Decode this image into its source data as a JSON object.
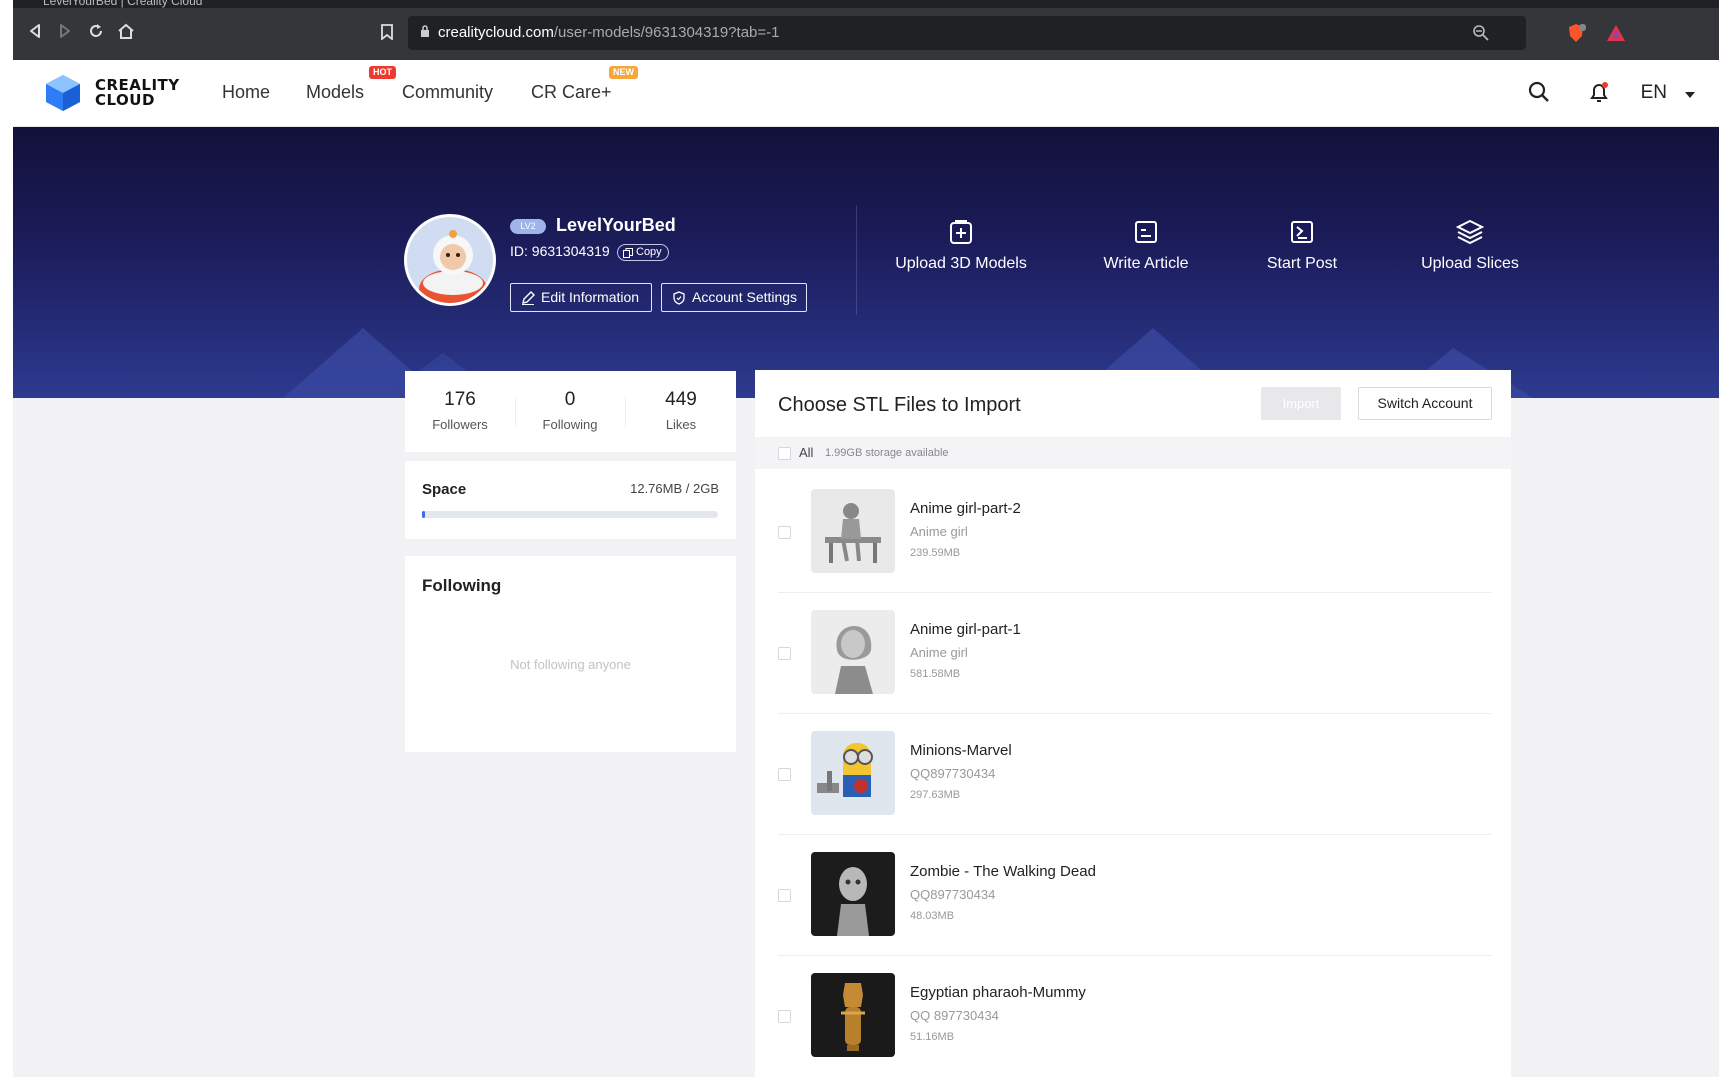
{
  "browser": {
    "tab_title": "LevelYourBed | Creality Cloud",
    "url_host": "crealitycloud.com",
    "url_path": "/user-models/9631304319?tab=-1"
  },
  "header": {
    "logo_line1": "CREALITY",
    "logo_line2": "CLOUD",
    "nav": [
      {
        "label": "Home"
      },
      {
        "label": "Models",
        "badge": "HOT"
      },
      {
        "label": "Community"
      },
      {
        "label": "CR Care+",
        "badge": "NEW"
      }
    ],
    "language": "EN"
  },
  "profile": {
    "level": "LV2",
    "username": "LevelYourBed",
    "id_text": "ID: 9631304319",
    "copy_label": "Copy",
    "edit_label": "Edit Information",
    "settings_label": "Account Settings"
  },
  "actions": [
    {
      "label": "Upload 3D Models",
      "icon": "upload-model-icon"
    },
    {
      "label": "Write Article",
      "icon": "article-icon"
    },
    {
      "label": "Start Post",
      "icon": "post-icon"
    },
    {
      "label": "Upload Slices",
      "icon": "layers-icon"
    }
  ],
  "stats": [
    {
      "value": "176",
      "label": "Followers"
    },
    {
      "value": "0",
      "label": "Following"
    },
    {
      "value": "449",
      "label": "Likes"
    }
  ],
  "space": {
    "title": "Space",
    "value": "12.76MB / 2GB",
    "used_fraction": 0.006
  },
  "following_card": {
    "title": "Following",
    "empty_text": "Not following anyone"
  },
  "import_panel": {
    "title": "Choose STL Files to Import",
    "import_label": "Import",
    "switch_label": "Switch Account",
    "all_label": "All",
    "storage_text": "1.99GB storage available",
    "files": [
      {
        "name": "Anime girl-part-2",
        "owner": "Anime girl",
        "size": "239.59MB"
      },
      {
        "name": "Anime girl-part-1",
        "owner": "Anime girl",
        "size": "581.58MB"
      },
      {
        "name": "Minions-Marvel",
        "owner": "QQ897730434",
        "size": "297.63MB"
      },
      {
        "name": "Zombie - The Walking Dead",
        "owner": "QQ897730434",
        "size": "48.03MB"
      },
      {
        "name": "Egyptian pharaoh-Mummy",
        "owner": "QQ 897730434",
        "size": "51.16MB"
      }
    ]
  },
  "colors": {
    "hero_dark": "#12113a",
    "hero_light": "#2d3a8f",
    "accent": "#3b6de0",
    "hot_badge": "#ef3b2f",
    "new_badge": "#f7a63a"
  }
}
